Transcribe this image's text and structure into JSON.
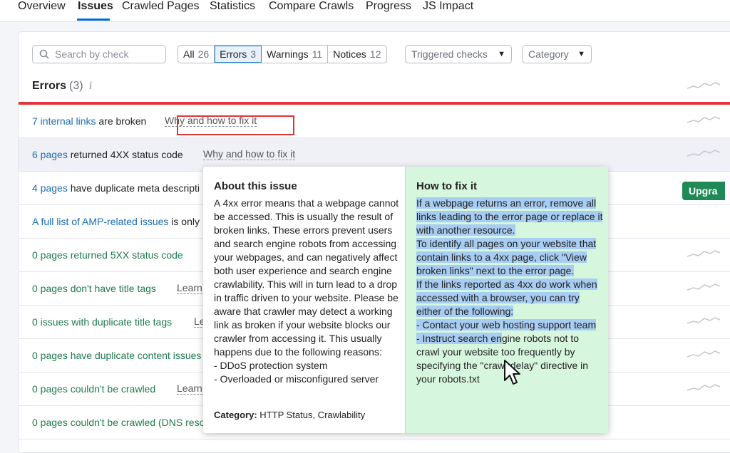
{
  "tabs": [
    {
      "label": "Overview",
      "active": false
    },
    {
      "label": "Issues",
      "active": true
    },
    {
      "label": "Crawled Pages",
      "active": false
    },
    {
      "label": "Statistics",
      "active": false
    },
    {
      "label": "Compare Crawls",
      "active": false
    },
    {
      "label": "Progress",
      "active": false
    },
    {
      "label": "JS Impact",
      "active": false
    }
  ],
  "filters": {
    "search_placeholder": "Search by check",
    "segments": [
      {
        "label": "All",
        "count": "26",
        "selected": false
      },
      {
        "label": "Errors",
        "count": "3",
        "selected": true
      },
      {
        "label": "Warnings",
        "count": "11",
        "selected": false
      },
      {
        "label": "Notices",
        "count": "12",
        "selected": false
      }
    ],
    "triggered_checks": "Triggered checks",
    "category": "Category"
  },
  "section": {
    "title": "Errors",
    "count": "(3)",
    "info_icon": "i"
  },
  "rows": [
    {
      "link": "7 internal links",
      "rest": " are broken",
      "why": "Why and how to fix it"
    },
    {
      "link": "6 pages",
      "rest": " returned 4XX status code",
      "why": "Why and how to fix it"
    },
    {
      "link": "4 pages",
      "rest": " have duplicate meta descripti",
      "why": ""
    },
    {
      "link": "A full list of AMP-related issues",
      "rest": " is only",
      "why": ""
    },
    {
      "text": "0 pages returned 5XX status code",
      "why": ""
    },
    {
      "text": "0 pages don't have title tags",
      "why": "Learn"
    },
    {
      "text": "0 issues with duplicate title tags",
      "why": "Le"
    },
    {
      "text": "0 pages have duplicate content issues",
      "why": ""
    },
    {
      "text": "0 pages couldn't be crawled",
      "why": "Learn"
    },
    {
      "text": "0 pages couldn't be crawled (DNS reso",
      "why": ""
    }
  ],
  "upgrade_label": "Upgra",
  "popover": {
    "about_title": "About this issue",
    "about_body": "A 4xx error means that a webpage cannot be accessed. This is usually the result of broken links. These errors prevent users and search engine robots from accessing your webpages, and can negatively affect both user experience and search engine crawlability. This will in turn lead to a drop in traffic driven to your website. Please be aware that crawler may detect a working link as broken if your website blocks our crawler from accessing it. This usually happens due to the following reasons:\n- DDoS protection system\n- Overloaded or misconfigured server",
    "category_label": "Category:",
    "category_value": " HTTP Status, Crawlability",
    "fix_title": "How to fix it",
    "fix_selected": "If a webpage returns an error, remove all links leading to the error page or replace it with another resource.\nTo identify all pages on your website that contain links to a 4xx page, click \"View broken links\" next to the error page.\nIf the links reported as 4xx do work when accessed with a browser, you can try either of the following:\n- Contact your web hosting support team\n- Instruct search en",
    "fix_rest": "gine robots not to crawl your website too frequently by specifying the \"crawl-delay\" directive in your robots.txt"
  },
  "colors": {
    "accent": "#006dca",
    "error_red": "#e0353b",
    "link_blue": "#1b6db5",
    "green_text": "#1f7a4d",
    "fix_bg": "#d7f6de",
    "selection": "#a7cdf2",
    "upgrade_green": "#1f8a55"
  }
}
